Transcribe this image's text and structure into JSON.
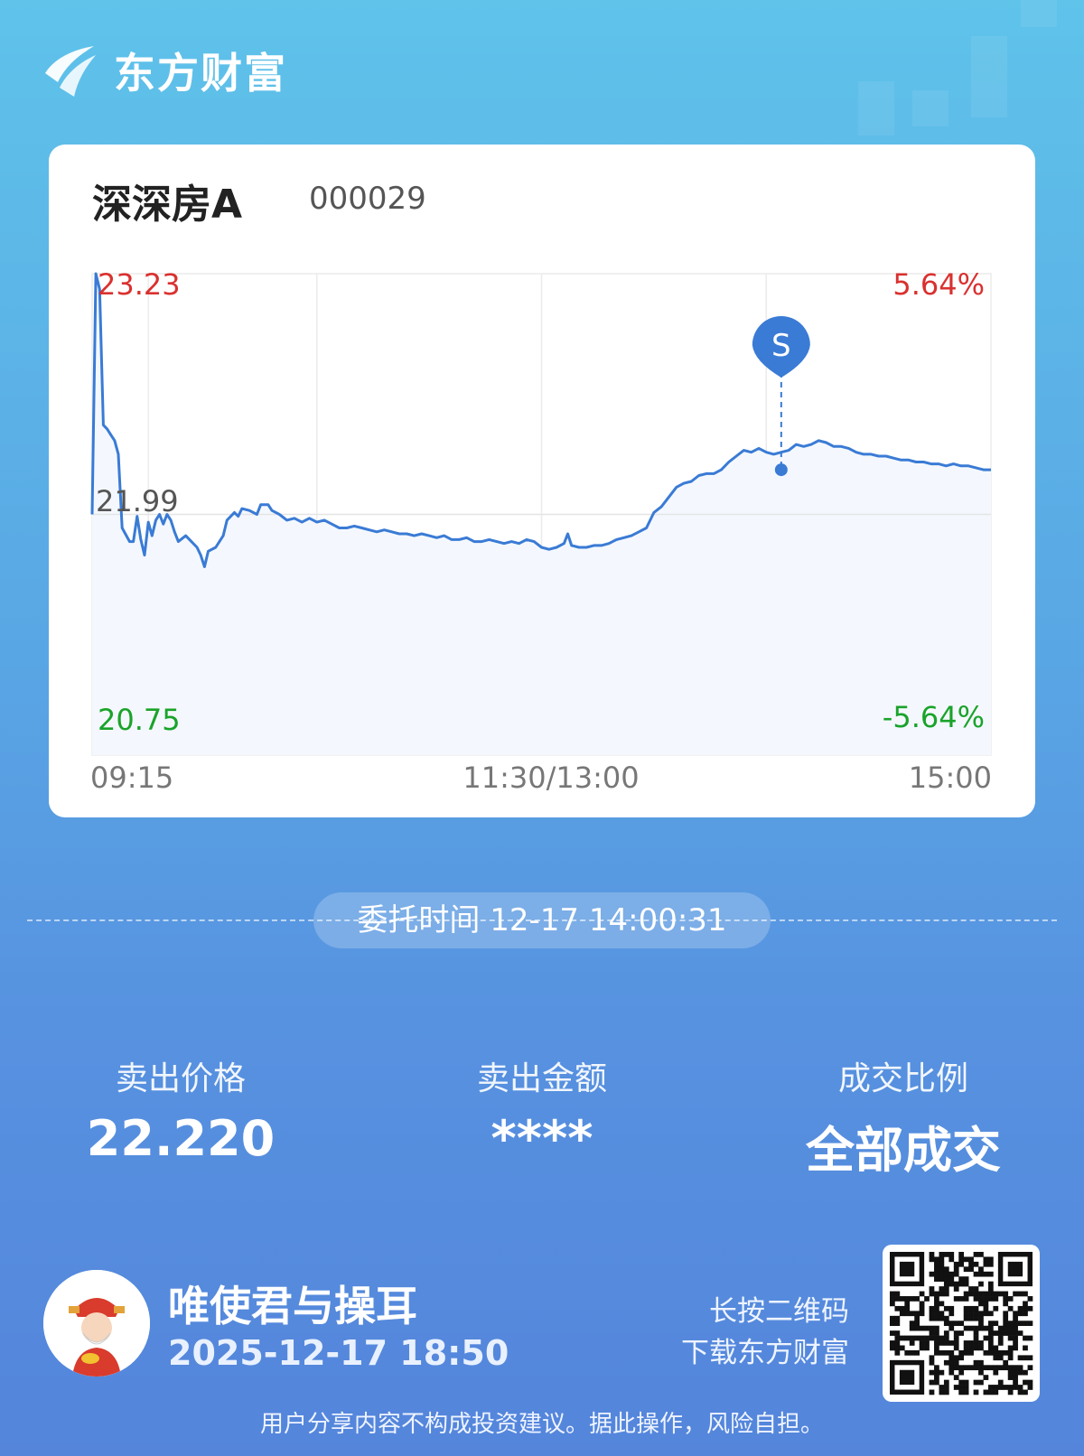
{
  "brand": {
    "name": "东方财富"
  },
  "stock": {
    "name": "深深房A",
    "code": "000029"
  },
  "chart_data": {
    "type": "line",
    "title": "",
    "price_max_label": "23.23",
    "price_mid_label": "21.99",
    "price_min_label": "20.75",
    "pct_max_label": "5.64%",
    "pct_min_label": "-5.64%",
    "x_tick_labels": [
      "09:15",
      "11:30/13:00",
      "15:00"
    ],
    "ylim": [
      20.75,
      23.23
    ],
    "prev_close": 21.99,
    "time_axis_minutes": 240,
    "series": [
      {
        "points": [
          [
            0,
            21.99
          ],
          [
            1,
            23.23
          ],
          [
            2,
            23.15
          ],
          [
            3,
            22.45
          ],
          [
            4,
            22.43
          ],
          [
            5,
            22.4
          ],
          [
            6,
            22.37
          ],
          [
            7,
            22.3
          ],
          [
            8,
            21.92
          ],
          [
            10,
            21.85
          ],
          [
            11,
            21.85
          ],
          [
            12,
            21.98
          ],
          [
            13,
            21.86
          ],
          [
            14,
            21.78
          ],
          [
            15,
            21.95
          ],
          [
            16,
            21.88
          ],
          [
            17,
            21.96
          ],
          [
            18,
            21.99
          ],
          [
            19,
            21.94
          ],
          [
            20,
            21.99
          ],
          [
            21,
            21.96
          ],
          [
            22,
            21.9
          ],
          [
            23,
            21.85
          ],
          [
            25,
            21.88
          ],
          [
            26,
            21.86
          ],
          [
            28,
            21.82
          ],
          [
            29,
            21.78
          ],
          [
            30,
            21.72
          ],
          [
            31,
            21.8
          ],
          [
            33,
            21.82
          ],
          [
            35,
            21.88
          ],
          [
            36,
            21.96
          ],
          [
            38,
            22.0
          ],
          [
            39,
            21.98
          ],
          [
            40,
            22.02
          ],
          [
            42,
            22.01
          ],
          [
            44,
            21.99
          ],
          [
            45,
            22.04
          ],
          [
            47,
            22.04
          ],
          [
            48,
            22.01
          ],
          [
            50,
            21.99
          ],
          [
            52,
            21.96
          ],
          [
            54,
            21.97
          ],
          [
            56,
            21.95
          ],
          [
            58,
            21.97
          ],
          [
            60,
            21.95
          ],
          [
            62,
            21.96
          ],
          [
            64,
            21.94
          ],
          [
            66,
            21.92
          ],
          [
            68,
            21.92
          ],
          [
            70,
            21.93
          ],
          [
            72,
            21.92
          ],
          [
            74,
            21.91
          ],
          [
            76,
            21.9
          ],
          [
            78,
            21.91
          ],
          [
            80,
            21.9
          ],
          [
            82,
            21.89
          ],
          [
            84,
            21.89
          ],
          [
            86,
            21.88
          ],
          [
            88,
            21.89
          ],
          [
            90,
            21.88
          ],
          [
            92,
            21.87
          ],
          [
            94,
            21.88
          ],
          [
            96,
            21.86
          ],
          [
            98,
            21.86
          ],
          [
            100,
            21.87
          ],
          [
            102,
            21.85
          ],
          [
            104,
            21.85
          ],
          [
            106,
            21.86
          ],
          [
            108,
            21.85
          ],
          [
            110,
            21.84
          ],
          [
            112,
            21.85
          ],
          [
            114,
            21.84
          ],
          [
            116,
            21.86
          ],
          [
            118,
            21.85
          ],
          [
            120,
            21.82
          ],
          [
            122,
            21.81
          ],
          [
            124,
            21.82
          ],
          [
            126,
            21.84
          ],
          [
            127,
            21.89
          ],
          [
            128,
            21.83
          ],
          [
            130,
            21.82
          ],
          [
            132,
            21.82
          ],
          [
            134,
            21.83
          ],
          [
            136,
            21.83
          ],
          [
            138,
            21.84
          ],
          [
            140,
            21.86
          ],
          [
            142,
            21.87
          ],
          [
            144,
            21.88
          ],
          [
            146,
            21.9
          ],
          [
            148,
            21.92
          ],
          [
            150,
            22.0
          ],
          [
            152,
            22.03
          ],
          [
            154,
            22.08
          ],
          [
            156,
            22.13
          ],
          [
            158,
            22.15
          ],
          [
            160,
            22.16
          ],
          [
            162,
            22.19
          ],
          [
            164,
            22.2
          ],
          [
            166,
            22.2
          ],
          [
            168,
            22.22
          ],
          [
            170,
            22.26
          ],
          [
            172,
            22.29
          ],
          [
            174,
            22.32
          ],
          [
            176,
            22.31
          ],
          [
            178,
            22.33
          ],
          [
            180,
            22.31
          ],
          [
            182,
            22.3
          ],
          [
            184,
            22.31
          ],
          [
            186,
            22.32
          ],
          [
            188,
            22.35
          ],
          [
            190,
            22.34
          ],
          [
            192,
            22.35
          ],
          [
            194,
            22.37
          ],
          [
            196,
            22.36
          ],
          [
            198,
            22.34
          ],
          [
            200,
            22.34
          ],
          [
            202,
            22.33
          ],
          [
            204,
            22.31
          ],
          [
            206,
            22.3
          ],
          [
            208,
            22.3
          ],
          [
            210,
            22.29
          ],
          [
            212,
            22.29
          ],
          [
            214,
            22.28
          ],
          [
            216,
            22.27
          ],
          [
            218,
            22.27
          ],
          [
            220,
            22.26
          ],
          [
            222,
            22.26
          ],
          [
            224,
            22.25
          ],
          [
            226,
            22.25
          ],
          [
            228,
            22.24
          ],
          [
            230,
            22.25
          ],
          [
            232,
            22.24
          ],
          [
            234,
            22.24
          ],
          [
            236,
            22.23
          ],
          [
            238,
            22.22
          ],
          [
            240,
            22.22
          ]
        ]
      }
    ],
    "sell_marker": {
      "label": "S",
      "time_minute": 184,
      "price": 22.22
    }
  },
  "order": {
    "time_text": "委托时间 12-17 14:00:31"
  },
  "stats": [
    {
      "label": "卖出价格",
      "value": "22.220"
    },
    {
      "label": "卖出金额",
      "value": "****"
    },
    {
      "label": "成交比例",
      "value": "全部成交"
    }
  ],
  "user": {
    "name": "唯使君与操耳",
    "time": "2025-12-17 18:50"
  },
  "qr": {
    "hint_line1": "长按二维码",
    "hint_line2": "下载东方财富"
  },
  "disclaimer": "用户分享内容不构成投资建议。据此操作，风险自担。",
  "colors": {
    "up": "#d9312f",
    "down": "#1aa32a",
    "line": "#3a7bd5",
    "fill": "#f4f8fe",
    "grid": "#ebebeb"
  },
  "icons": {
    "brand_logo": "eastmoney-logo-icon",
    "avatar": "fortune-god-avatar",
    "qr": "qr-code"
  }
}
